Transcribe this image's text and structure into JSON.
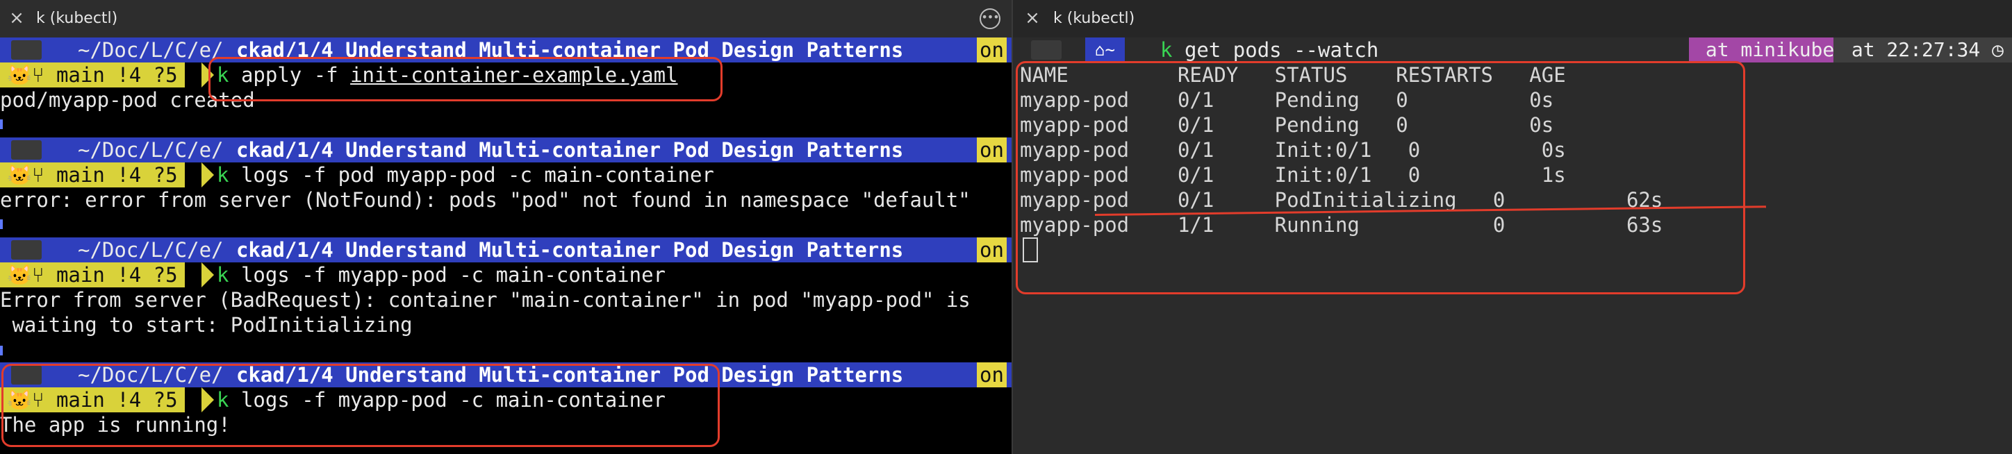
{
  "left": {
    "title": "k (kubectl)",
    "more_icon": "ellipsis-icon",
    "prompt": {
      "path_dim": "~/Doc/L/C/e/",
      "path_bold": "ckad/1/4 Understand Multi-container Pod Design Patterns",
      "on": "on",
      "git": "main !4 ?5",
      "k": "k"
    },
    "blocks": [
      {
        "cmd": "apply -f ",
        "cmd_file": "init-container-example.yaml",
        "out": [
          "pod/myapp-pod created"
        ]
      },
      {
        "cmd": "logs -f pod myapp-pod -c main-container",
        "out": [
          "error: error from server (NotFound): pods \"pod\" not found in namespace \"default\""
        ]
      },
      {
        "cmd": "logs -f myapp-pod -c main-container",
        "out": [
          "Error from server (BadRequest): container \"main-container\" in pod \"myapp-pod\" is",
          " waiting to start: PodInitializing"
        ]
      },
      {
        "cmd": "logs -f myapp-pod -c main-container",
        "out": [
          "The app is running!"
        ]
      }
    ]
  },
  "right": {
    "title": "k (kubectl)",
    "prompt": {
      "home": "~",
      "k": "k",
      "cmd": "get pods --watch",
      "check": "✔",
      "context": "at minikube",
      "time": "at 22:27:34"
    },
    "table": {
      "header": "NAME         READY   STATUS    RESTARTS   AGE",
      "rows": [
        "myapp-pod    0/1     Pending   0          0s",
        "myapp-pod    0/1     Pending   0          0s",
        "myapp-pod    0/1     Init:0/1   0          0s",
        "myapp-pod    0/1     Init:0/1   0          1s",
        "myapp-pod    0/1     PodInitializing   0          62s",
        "myapp-pod    1/1     Running           0          63s"
      ]
    }
  },
  "colors": {
    "path_bg": "#2f3fbd",
    "git_bg": "#d9d23a",
    "on_bg": "#e6d742",
    "prompt_k": "#39d353",
    "annotation": "#e23c2b",
    "context_bg": "#a347a6"
  }
}
